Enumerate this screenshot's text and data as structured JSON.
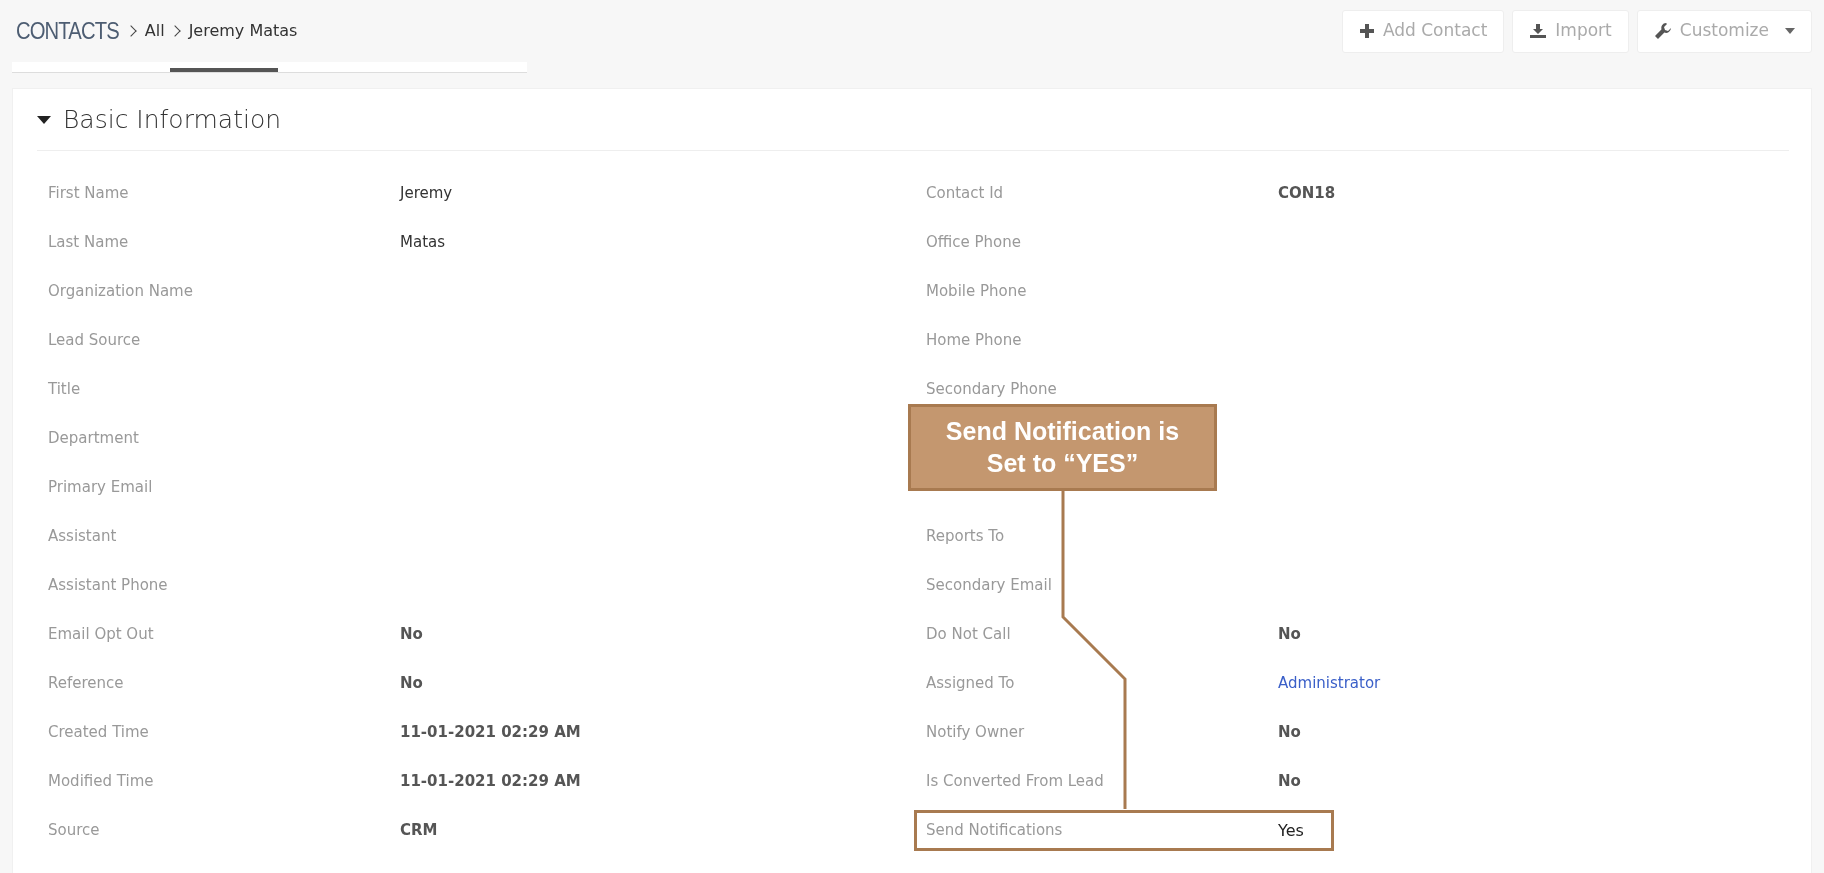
{
  "breadcrumb": {
    "module": "CONTACTS",
    "items": [
      "All",
      "Jeremy Matas"
    ]
  },
  "header_buttons": [
    {
      "label": "Add Contact",
      "kind": "add",
      "caret": false
    },
    {
      "label": "Import",
      "kind": "import",
      "caret": false
    },
    {
      "label": "Customize",
      "kind": "customize",
      "caret": true
    }
  ],
  "section": {
    "title": "Basic Information",
    "expanded": true
  },
  "left_fields": [
    {
      "label": "First Name",
      "value": "Jeremy"
    },
    {
      "label": "Last Name",
      "value": "Matas"
    },
    {
      "label": "Organization Name"
    },
    {
      "label": "Lead Source"
    },
    {
      "label": "Title"
    },
    {
      "label": "Department"
    },
    {
      "label": "Primary Email"
    },
    {
      "label": "Assistant"
    },
    {
      "label": "Assistant Phone"
    },
    {
      "label": "Email Opt Out",
      "value": "No"
    },
    {
      "label": "Reference",
      "value": "No"
    },
    {
      "label": "Created Time",
      "value": "11-01-2021 02:29 AM"
    },
    {
      "label": "Modified Time",
      "value": "11-01-2021 02:29 AM"
    },
    {
      "label": "Source",
      "value": "CRM"
    }
  ],
  "right_fields": [
    {
      "label": "Contact Id",
      "value": "CON18",
      "highlighted": false
    },
    {
      "label": "Office Phone",
      "highlighted": false
    },
    {
      "label": "Mobile Phone",
      "highlighted": false
    },
    {
      "label": "Home Phone",
      "highlighted": false
    },
    {
      "label": "Secondary Phone",
      "highlighted": false
    },
    {
      "highlighted": false
    },
    {
      "highlighted": false
    },
    {
      "label": "Reports To",
      "highlighted": false
    },
    {
      "label": "Secondary Email",
      "highlighted": false
    },
    {
      "label": "Do Not Call",
      "value": "No",
      "highlighted": false
    },
    {
      "label": "Assigned To",
      "value": "Administrator",
      "kind": "link",
      "highlighted": false
    },
    {
      "label": "Notify Owner",
      "value": "No",
      "highlighted": false
    },
    {
      "label": "Is Converted From Lead",
      "value": "No",
      "highlighted": false
    },
    {
      "label": "Send Notifications",
      "value": "Yes",
      "highlighted": true
    }
  ],
  "callout": {
    "text": "Send Notification is Set to “YES”"
  }
}
